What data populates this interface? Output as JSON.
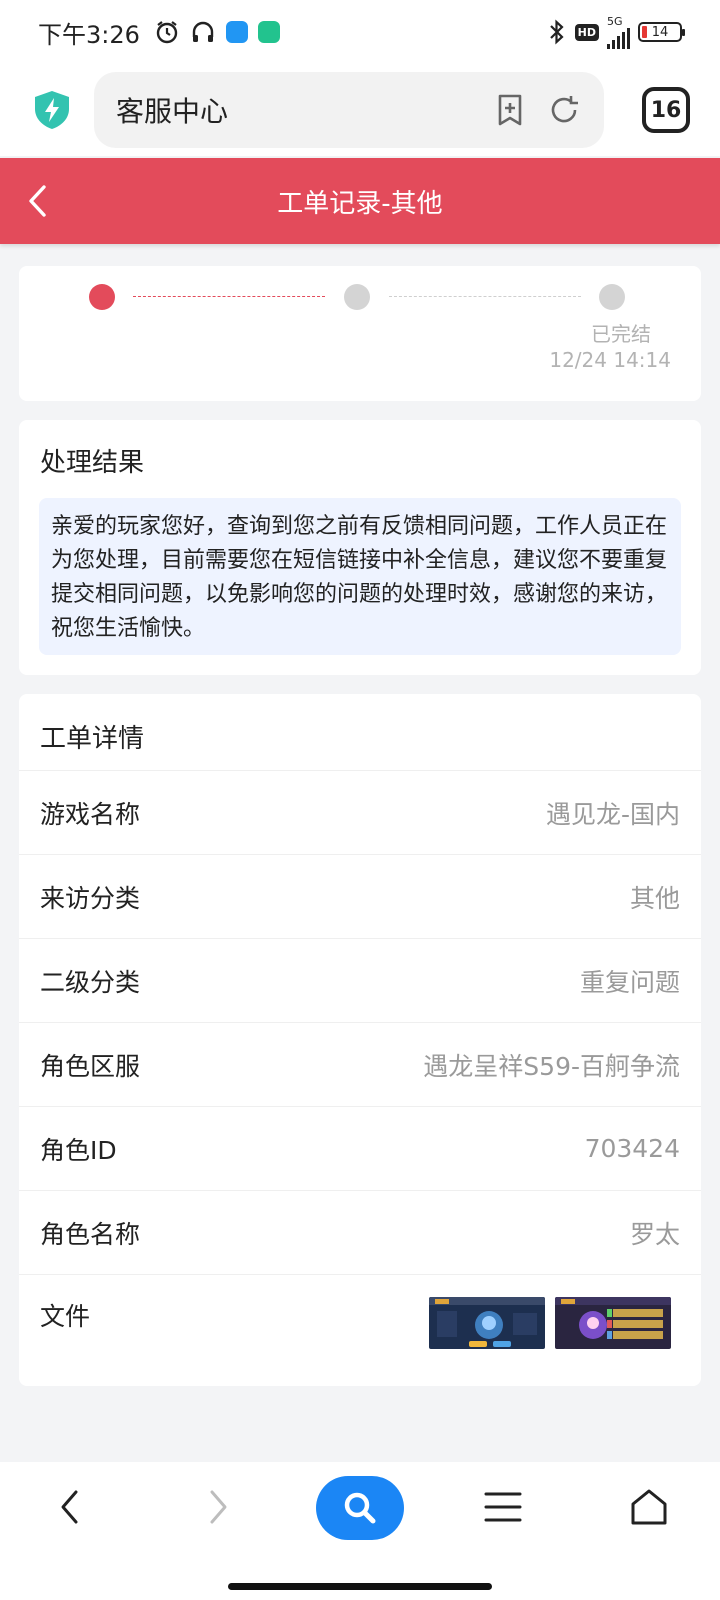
{
  "status_bar": {
    "time": "下午3:26",
    "network": "5G",
    "hd": "HD",
    "battery": "14"
  },
  "browser": {
    "address_text": "客服中心",
    "tab_count": "16"
  },
  "header": {
    "title": "工单记录-其他",
    "accent_color": "#e34b5b"
  },
  "progress": {
    "steps": [
      {
        "state": "active"
      },
      {
        "state": "inactive"
      },
      {
        "state": "inactive",
        "status": "已完结",
        "time": "12/24 14:14"
      }
    ]
  },
  "result": {
    "title": "处理结果",
    "text": "亲爱的玩家您好，查询到您之前有反馈相同问题，工作人员正在为您处理，目前需要您在短信链接中补全信息，建议您不要重复提交相同问题，以免影响您的问题的处理时效，感谢您的来访，祝您生活愉快。"
  },
  "details": {
    "title": "工单详情",
    "rows": [
      {
        "label": "游戏名称",
        "value": "遇见龙-国内"
      },
      {
        "label": "来访分类",
        "value": "其他"
      },
      {
        "label": "二级分类",
        "value": "重复问题"
      },
      {
        "label": "角色区服",
        "value": "遇龙呈祥S59-百舸争流"
      },
      {
        "label": "角色ID",
        "value": "703424"
      },
      {
        "label": "角色名称",
        "value": "罗太"
      }
    ],
    "file_label": "文件"
  },
  "bottom_nav": {
    "items": [
      "back-icon",
      "forward-icon",
      "search-icon",
      "menu-icon",
      "home-icon"
    ]
  }
}
